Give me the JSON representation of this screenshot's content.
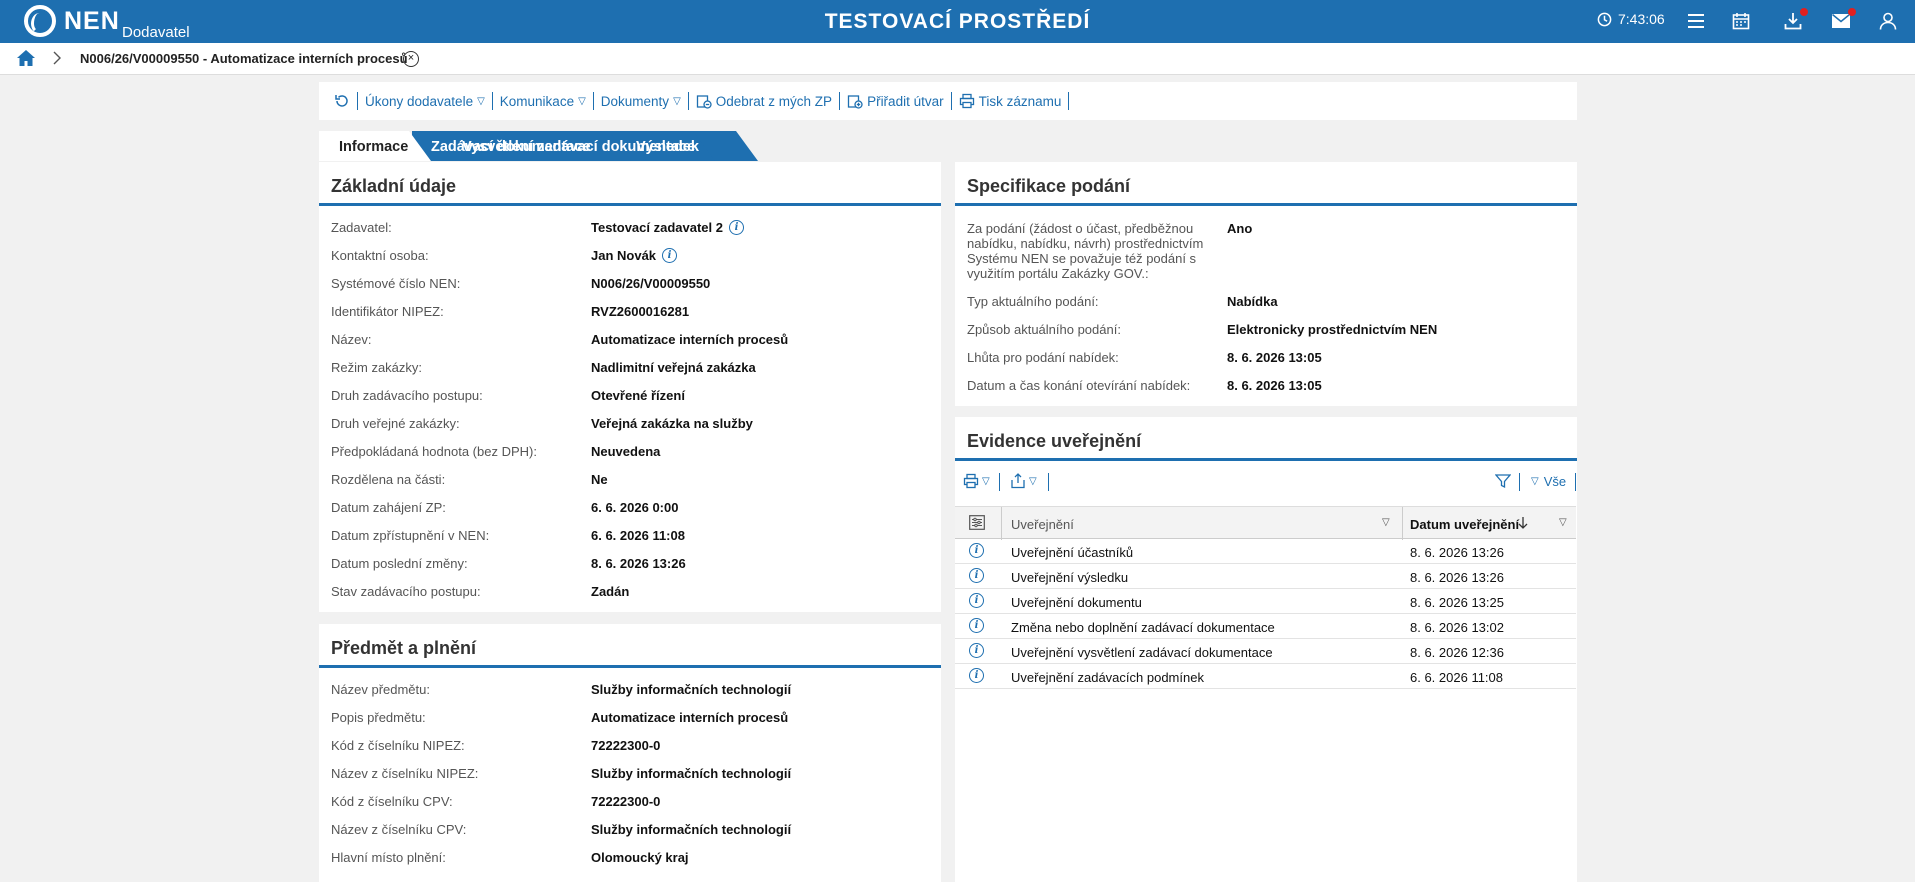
{
  "topbar": {
    "logo": "NEN",
    "logo_sub": "Dodavatel",
    "env_title": "TESTOVACÍ PROSTŘEDÍ",
    "time": "7:43:06",
    "icons": [
      "clock-icon",
      "menu-icon",
      "calendar-icon",
      "download-icon",
      "mail-icon",
      "user-icon"
    ]
  },
  "breadcrumb": {
    "text": "N006/26/V00009550 - Automatizace interních procesů"
  },
  "toolbar": {
    "items": [
      {
        "label": "Úkony dodavatele",
        "dropdown": true
      },
      {
        "label": "Komunikace",
        "dropdown": true
      },
      {
        "label": "Dokumenty",
        "dropdown": true
      },
      {
        "label": "Odebrat z mých ZP"
      },
      {
        "label": "Přiřadit útvar"
      },
      {
        "label": "Tisk záznamu"
      }
    ]
  },
  "tabs": [
    "Informace",
    "Zadávací dokumentace",
    "Vysvětlení zadávací dokumentace",
    "Výsledek"
  ],
  "zakladni": {
    "title": "Základní údaje",
    "rows": [
      {
        "label": "Zadavatel:",
        "value": "Testovací zadavatel 2"
      },
      {
        "label": "Kontaktní osoba:",
        "value": "Jan Novák"
      },
      {
        "label": "Systémové číslo NEN:",
        "value": "N006/26/V00009550"
      },
      {
        "label": "Identifikátor NIPEZ:",
        "value": "RVZ2600016281"
      },
      {
        "label": "Název:",
        "value": "Automatizace interních procesů"
      },
      {
        "label": "Režim zakázky:",
        "value": "Nadlimitní veřejná zakázka"
      },
      {
        "label": "Druh zadávacího postupu:",
        "value": "Otevřené řízení"
      },
      {
        "label": "Druh veřejné zakázky:",
        "value": "Veřejná zakázka na služby"
      },
      {
        "label": "Předpokládaná hodnota (bez DPH):",
        "value": "Neuvedena"
      },
      {
        "label": "Rozdělena na části:",
        "value": "Ne"
      },
      {
        "label": "Datum zahájení ZP:",
        "value": "6. 6. 2026 0:00"
      },
      {
        "label": "Datum zpřístupnění v NEN:",
        "value": "6. 6. 2026 11:08"
      },
      {
        "label": "Datum poslední změny:",
        "value": "8. 6. 2026 13:26"
      },
      {
        "label": "Stav zadávacího postupu:",
        "value": "Zadán"
      }
    ]
  },
  "predmet": {
    "title": "Předmět a plnění",
    "rows": [
      {
        "label": "Název předmětu:",
        "value": "Služby informačních technologií"
      },
      {
        "label": "Popis předmětu:",
        "value": "Automatizace interních procesů"
      },
      {
        "label": "Kód z číselníku NIPEZ:",
        "value": "72222300-0"
      },
      {
        "label": "Název z číselníku NIPEZ:",
        "value": "Služby informačních technologií"
      },
      {
        "label": "Kód z číselníku CPV:",
        "value": "72222300-0"
      },
      {
        "label": "Název z číselníku CPV:",
        "value": "Služby informačních technologií"
      },
      {
        "label": "Hlavní místo plnění:",
        "value": "Olomoucký kraj"
      }
    ]
  },
  "specifikace": {
    "title": "Specifikace podání",
    "rows": [
      {
        "label": "Za podání (žádost o účast, předběžnou nabídku, nabídku, návrh) prostřednictvím Systému NEN se považuje též podání s využitím portálu Zakázky GOV.:",
        "value": "Ano"
      },
      {
        "label": "Typ aktuálního podání:",
        "value": "Nabídka"
      },
      {
        "label": "Způsob aktuálního podání:",
        "value": "Elektronicky prostřednictvím NEN"
      },
      {
        "label": "Lhůta pro podání nabídek:",
        "value": "8. 6. 2026 13:05"
      },
      {
        "label": "Datum a čas konání otevírání nabídek:",
        "value": "8. 6. 2026 13:05"
      }
    ]
  },
  "evidence": {
    "title": "Evidence uveřejnění",
    "filter_label": "Vše",
    "columns": [
      "Uveřejnění",
      "Datum uveřejnění"
    ],
    "rows": [
      {
        "name": "Uveřejnění účastníků",
        "date": "8. 6. 2026 13:26"
      },
      {
        "name": "Uveřejnění výsledku",
        "date": "8. 6. 2026 13:26"
      },
      {
        "name": "Uveřejnění dokumentu",
        "date": "8. 6. 2026 13:25"
      },
      {
        "name": "Změna nebo doplnění zadávací dokumentace",
        "date": "8. 6. 2026 13:02"
      },
      {
        "name": "Uveřejnění vysvětlení zadávací dokumentace",
        "date": "8. 6. 2026 12:36"
      },
      {
        "name": "Uveřejnění zadávacích podmínek",
        "date": "6. 6. 2026 11:08"
      }
    ]
  },
  "colors": {
    "accent": "#1e6fb0",
    "notify": "#e02020"
  }
}
